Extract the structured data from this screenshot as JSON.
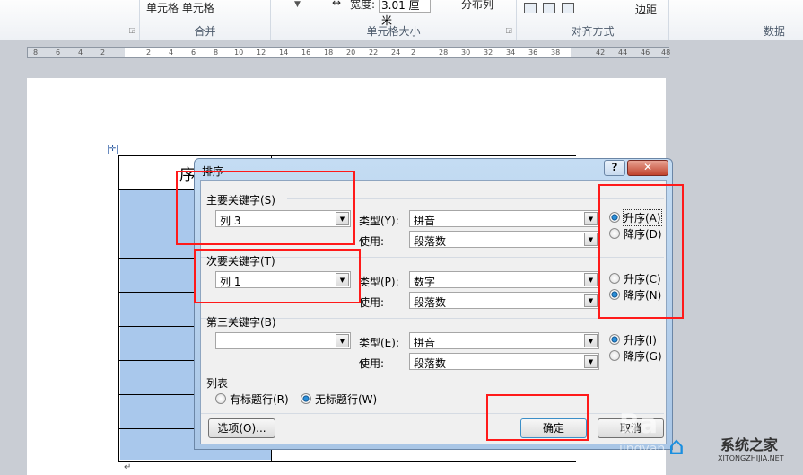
{
  "ribbon": {
    "merge_cells": "单元格 单元格",
    "width_label": "宽度:",
    "width_value": "3.01 厘米",
    "distribute_cols": "分布列",
    "margins": "边距",
    "groups": [
      "合并",
      "单元格大小",
      "对齐方式",
      "数据"
    ]
  },
  "ruler": {
    "left_ticks": [
      "8",
      "6",
      "4",
      "2"
    ],
    "ticks": [
      "2",
      "4",
      "6",
      "8",
      "10",
      "12",
      "14",
      "16",
      "18",
      "20",
      "22",
      "24",
      "2",
      "28",
      "30",
      "32",
      "34",
      "36",
      "38",
      "42",
      "44",
      "46",
      "48"
    ]
  },
  "table": {
    "header_first": "序"
  },
  "dialog": {
    "title": "排序",
    "help": "?",
    "close": "✕",
    "primary": {
      "label": "主要关键字(S)",
      "value": "列 3",
      "type_label": "类型(Y):",
      "type_value": "拼音",
      "use_label": "使用:",
      "use_value": "段落数",
      "asc": "升序(A)",
      "desc": "降序(D)",
      "order": "asc"
    },
    "secondary": {
      "label": "次要关键字(T)",
      "value": "列 1",
      "type_label": "类型(P):",
      "type_value": "数字",
      "use_label": "使用:",
      "use_value": "段落数",
      "asc": "升序(C)",
      "desc": "降序(N)",
      "order": "desc"
    },
    "third": {
      "label": "第三关键字(B)",
      "value": "",
      "type_label": "类型(E):",
      "type_value": "拼音",
      "use_label": "使用:",
      "use_value": "段落数",
      "asc": "升序(I)",
      "desc": "降序(G)",
      "order": "asc"
    },
    "list": {
      "label": "列表",
      "header_row": "有标题行(R)",
      "no_header_row": "无标题行(W)",
      "selected": "no_header_row"
    },
    "options_button": "选项(O)...",
    "ok_button": "确定",
    "cancel_button": "取消"
  },
  "watermark": {
    "brand": "系统之家",
    "url": "XITONGZHIJIA.NET",
    "jingyan": "jingyan"
  }
}
